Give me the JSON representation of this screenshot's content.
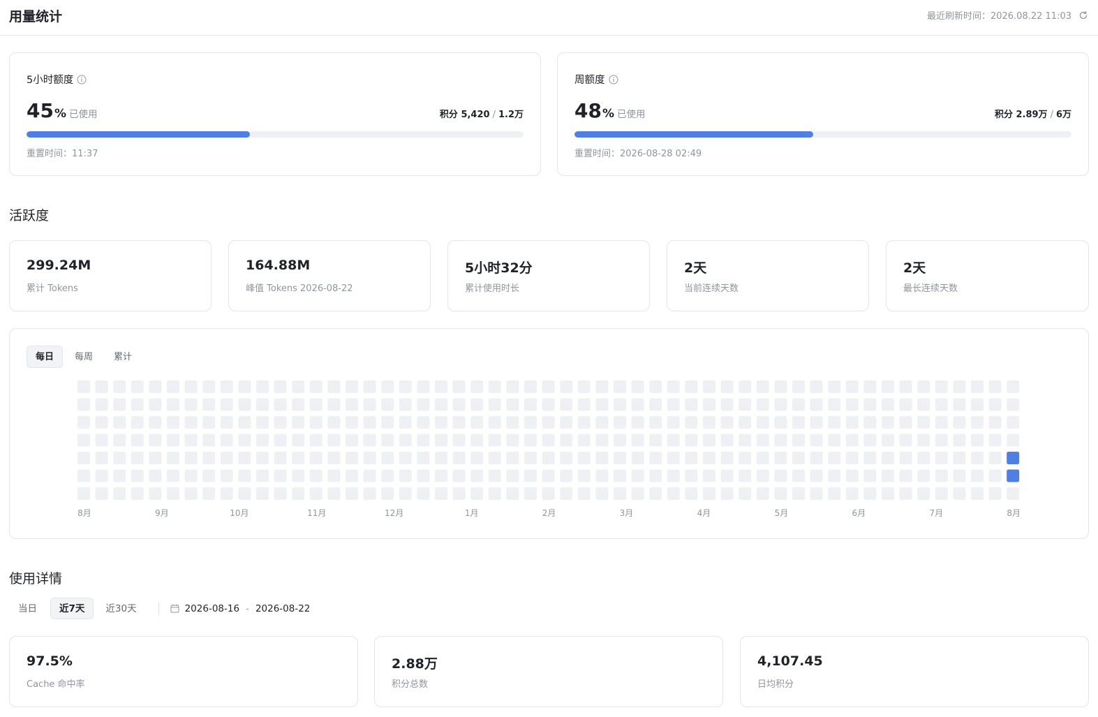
{
  "header": {
    "title": "用量统计",
    "refresh_label": "最近刷新时间：2026.08.22 11:03",
    "refresh_icon": "refresh-icon"
  },
  "quota": [
    {
      "title": "5小时额度",
      "percent": "45",
      "percent_sign": "%",
      "used_label": "已使用",
      "points_label": "积分 5,420",
      "points_sep": "/",
      "points_total": "1.2万",
      "progress": 0.45,
      "reset": "重置时间：11:37"
    },
    {
      "title": "周额度",
      "percent": "48",
      "percent_sign": "%",
      "used_label": "已使用",
      "points_label": "积分 2.89万",
      "points_sep": "/",
      "points_total": "6万",
      "progress": 0.48,
      "reset": "重置时间：2026-08-28 02:49"
    }
  ],
  "activity": {
    "title": "活跃度",
    "stats": [
      {
        "value": "299.24M",
        "label": "累计 Tokens"
      },
      {
        "value": "164.88M",
        "label": "峰值 Tokens 2026-08-22"
      },
      {
        "value": "5小时32分",
        "label": "累计使用时长"
      },
      {
        "value": "2天",
        "label": "当前连续天数"
      },
      {
        "value": "2天",
        "label": "最长连续天数"
      }
    ],
    "tabs": [
      "每日",
      "每周",
      "累计"
    ],
    "active_tab": 0,
    "heatmap": {
      "weeks": 53,
      "days": 7,
      "active_cells": [
        [
          52,
          4
        ],
        [
          52,
          5
        ]
      ],
      "empty_color": "#eff0f3",
      "active_color": "#4f7fe3",
      "months": [
        "8月",
        "9月",
        "10月",
        "11月",
        "12月",
        "1月",
        "2月",
        "3月",
        "4月",
        "5月",
        "6月",
        "7月",
        "8月"
      ]
    }
  },
  "details": {
    "title": "使用详情",
    "tabs": [
      "当日",
      "近7天",
      "近30天"
    ],
    "active_tab": 1,
    "date_start": "2026-08-16",
    "date_sep": "-",
    "date_end": "2026-08-22",
    "stats": [
      {
        "value": "97.5%",
        "label": "Cache 命中率"
      },
      {
        "value": "2.88万",
        "label": "积分总数"
      },
      {
        "value": "4,107.45",
        "label": "日均积分"
      }
    ]
  },
  "colors": {
    "accent": "#4f7fe3",
    "border": "#e3e5e8",
    "muted_text": "#8f959e"
  }
}
